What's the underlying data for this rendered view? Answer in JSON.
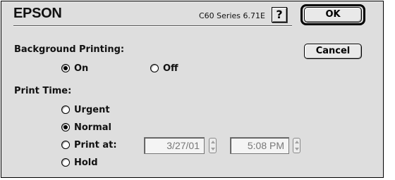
{
  "header": {
    "brand": "EPSON",
    "version": "C60 Series 6.71E",
    "help_label": "?"
  },
  "buttons": {
    "ok_label": "OK",
    "cancel_label": "Cancel"
  },
  "background_printing": {
    "label": "Background Printing:",
    "options": [
      {
        "label": "On",
        "checked": true
      },
      {
        "label": "Off",
        "checked": false
      }
    ]
  },
  "print_time": {
    "label": "Print Time:",
    "options": [
      {
        "label": "Urgent",
        "checked": false
      },
      {
        "label": "Normal",
        "checked": true
      },
      {
        "label": "Print at:",
        "checked": false
      },
      {
        "label": "Hold",
        "checked": false
      }
    ],
    "date_value": "3/27/01",
    "time_value": "5:08 PM"
  },
  "colors": {
    "dialog_bg": "#dedede",
    "disabled_text": "#777777"
  }
}
